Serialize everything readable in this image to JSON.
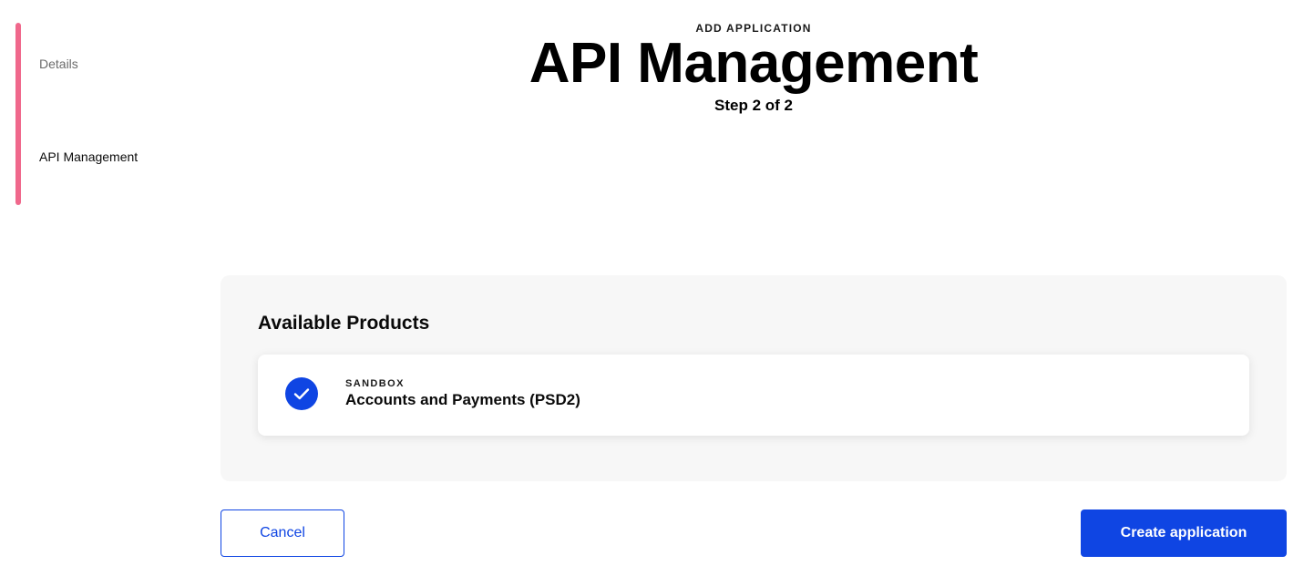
{
  "sidebar": {
    "steps": [
      {
        "label": "Details",
        "active": false
      },
      {
        "label": "API Management",
        "active": true
      }
    ],
    "accent_color": "#f0688c"
  },
  "header": {
    "kicker": "ADD APPLICATION",
    "title": "API Management",
    "step_text": "Step 2 of 2"
  },
  "products": {
    "title": "Available Products",
    "items": [
      {
        "environment": "SANDBOX",
        "name": "Accounts and Payments (PSD2)",
        "selected": true,
        "icon": "check-icon"
      }
    ]
  },
  "actions": {
    "cancel_label": "Cancel",
    "create_label": "Create application"
  },
  "colors": {
    "primary": "#0f45e3",
    "panel_bg": "#f7f7f7"
  }
}
